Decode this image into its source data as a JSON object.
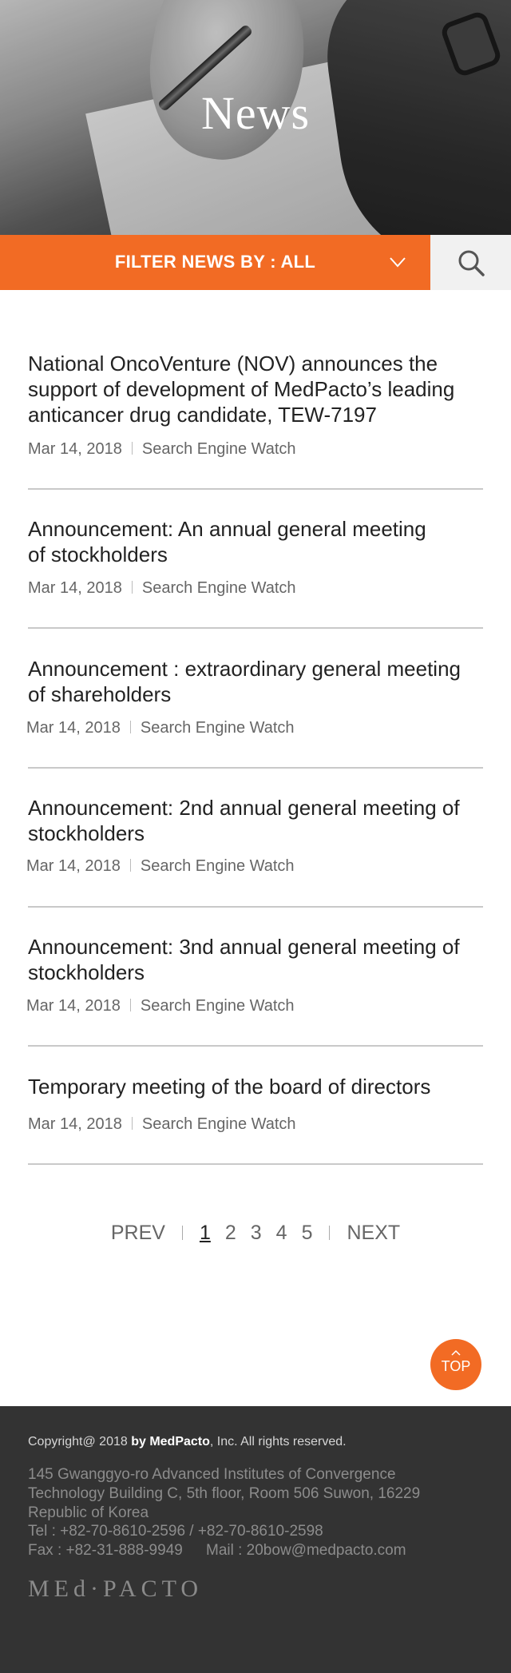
{
  "hero": {
    "title": "News"
  },
  "filter": {
    "label": "FILTER NEWS BY : ALL"
  },
  "news": [
    {
      "title": "National OncoVenture (NOV) announces the support of development of MedPacto’s leading anticancer drug candidate, TEW-7197",
      "date": "Mar 14, 2018",
      "source": "Search Engine Watch"
    },
    {
      "title": "Announcement: An annual general meeting of stockholders",
      "date": "Mar 14, 2018",
      "source": "Search Engine Watch"
    },
    {
      "title": "Announcement : extraordinary general meeting of shareholders",
      "date": "Mar 14, 2018",
      "source": "Search Engine Watch"
    },
    {
      "title": "Announcement: 2nd annual general meeting of stockholders",
      "date": "Mar 14, 2018",
      "source": "Search Engine Watch"
    },
    {
      "title": "Announcement: 3nd annual general meeting of stockholders",
      "date": "Mar 14, 2018",
      "source": "Search Engine Watch"
    },
    {
      "title": "Temporary meeting of the board of directors",
      "date": "Mar 14, 2018",
      "source": "Search Engine Watch"
    }
  ],
  "pagination": {
    "prev": "PREV",
    "next": "NEXT",
    "pages": [
      "1",
      "2",
      "3",
      "4",
      "5"
    ],
    "current": "1"
  },
  "top_button": {
    "label": "TOP"
  },
  "footer": {
    "copyright_prefix": "Copyright@ 2018 ",
    "copyright_bold": "by MedPacto",
    "copyright_suffix": ", Inc. All rights reserved.",
    "address": "145 Gwanggyo-ro Advanced Institutes of Convergence Technology Building C, 5th floor, Room 506 Suwon, 16229 Republic of Korea",
    "tel": "Tel : +82-70-8610-2596 / +82-70-8610-2598",
    "fax": "Fax : +82-31-888-9949",
    "mail": "Mail : 20bow@medpacto.com",
    "logo": "MEd·PACTO"
  },
  "colors": {
    "accent": "#f26b24",
    "footer_bg": "#333333",
    "search_bg": "#f1f1f1"
  }
}
